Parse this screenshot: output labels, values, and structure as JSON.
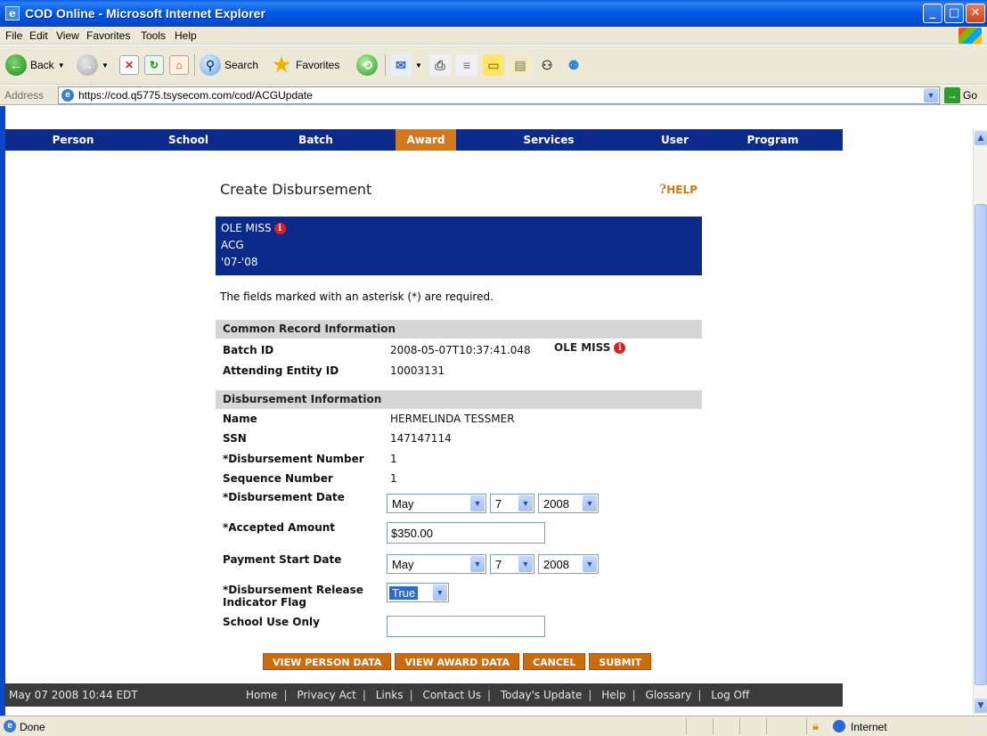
{
  "window": {
    "title": "COD Online - Microsoft Internet Explorer"
  },
  "menubar": {
    "items": [
      "File",
      "Edit",
      "View",
      "Favorites",
      "Tools",
      "Help"
    ]
  },
  "toolbar": {
    "back": "Back",
    "search": "Search",
    "favorites": "Favorites"
  },
  "address": {
    "label": "Address",
    "url": "https://cod.q5775.tsysecom.com/cod/ACGUpdate",
    "go": "Go"
  },
  "nav": {
    "items": [
      "Person",
      "School",
      "Batch",
      "Award",
      "Services",
      "User",
      "Program"
    ],
    "active": "Award"
  },
  "page": {
    "title": "Create Disbursement",
    "help": "HELP",
    "info_lines": [
      "OLE MISS",
      "ACG",
      "'07-'08"
    ],
    "required_note": "The fields marked with an asterisk (*) are required."
  },
  "common": {
    "header": "Common Record Information",
    "school": "OLE MISS",
    "batch_id_label": "Batch ID",
    "batch_id": "2008-05-07T10:37:41.048",
    "entity_label": "Attending Entity ID",
    "entity_id": "10003131"
  },
  "disbursement": {
    "header": "Disbursement Information",
    "name_label": "Name",
    "name": "HERMELINDA TESSMER",
    "ssn_label": "SSN",
    "ssn": "147147114",
    "number_label": "*Disbursement Number",
    "number": "1",
    "sequence_label": "Sequence Number",
    "sequence": "1",
    "date_label": "*Disbursement Date",
    "date": {
      "month": "May",
      "day": "7",
      "year": "2008"
    },
    "amount_label": "*Accepted Amount",
    "amount": "$350.00",
    "payment_label": "Payment Start Date",
    "payment": {
      "month": "May",
      "day": "7",
      "year": "2008"
    },
    "release_label_1": "*Disbursement Release",
    "release_label_2": "Indicator Flag",
    "release": "True",
    "school_use_label": "School Use Only",
    "school_use": ""
  },
  "buttons": {
    "view_person": "VIEW PERSON DATA",
    "view_award": "VIEW AWARD DATA",
    "cancel": "CANCEL",
    "submit": "SUBMIT"
  },
  "footer": {
    "timestamp": "May 07 2008 10:44 EDT",
    "links": [
      "Home",
      "Privacy Act",
      "Links",
      "Contact Us",
      "Today's Update",
      "Help",
      "Glossary",
      "Log Off"
    ]
  },
  "status": {
    "text": "Done",
    "zone": "Internet"
  },
  "colors": {
    "nav_bg": "#0b2a8a",
    "accent": "#d4781f",
    "button": "#cc6c10",
    "footer_bg": "#3b3b3b"
  }
}
